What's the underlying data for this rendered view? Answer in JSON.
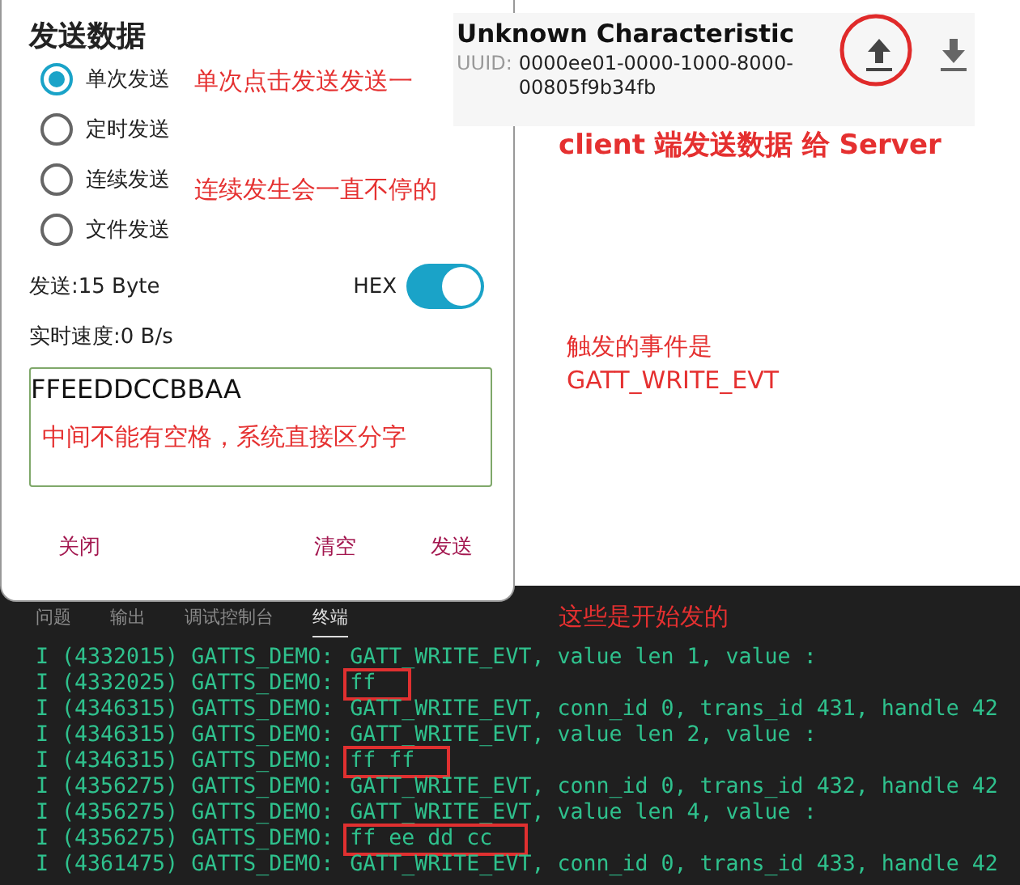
{
  "dialog": {
    "title": "发送数据",
    "options": [
      {
        "label": "单次发送",
        "selected": true
      },
      {
        "label": "定时发送",
        "selected": false
      },
      {
        "label": "连续发送",
        "selected": false
      },
      {
        "label": "文件发送",
        "selected": false
      }
    ],
    "sent": "发送:15 Byte",
    "hex": {
      "label": "HEX",
      "on": true
    },
    "speed": "实时速度:0 B/s",
    "input": {
      "value": "FFEEDDCCBBAA"
    },
    "buttons": [
      "关闭",
      "清空",
      "发送"
    ]
  },
  "characteristic": {
    "name": "Unknown Characteristic",
    "uuid_label": "UUID:",
    "uuid": "0000ee01-0000-1000-8000-00805f9b34fb"
  },
  "annotations": [
    "单次点击发送发送一",
    "连续发生会一直不停的",
    "中间不能有空格，系统直接区分字",
    "client 端发送数据 给 Server",
    "触发的事件是\nGATT_WRITE_EVT",
    "这些是开始发的"
  ],
  "terminal": {
    "tabs": [
      {
        "label": "问题",
        "selected": false
      },
      {
        "label": "输出",
        "selected": false
      },
      {
        "label": "调试控制台",
        "selected": false
      },
      {
        "label": "终端",
        "selected": true
      }
    ],
    "lines": [
      {
        "head": "I (4332015) GATTS_DEMO:",
        "body": "GATT_WRITE_EVT, value len 1, value :",
        "boxed": false
      },
      {
        "head": "I (4332025) GATTS_DEMO:",
        "body": "ff",
        "boxed": true
      },
      {
        "head": "I (4346315) GATTS_DEMO:",
        "body": "GATT_WRITE_EVT, conn_id 0, trans_id 431, handle 42",
        "boxed": false
      },
      {
        "head": "I (4346315) GATTS_DEMO:",
        "body": "GATT_WRITE_EVT, value len 2, value :",
        "boxed": false
      },
      {
        "head": "I (4346315) GATTS_DEMO:",
        "body": "ff ff",
        "boxed": true
      },
      {
        "head": "I (4356275) GATTS_DEMO:",
        "body": "GATT_WRITE_EVT, conn_id 0, trans_id 432, handle 42",
        "boxed": false
      },
      {
        "head": "I (4356275) GATTS_DEMO:",
        "body": "GATT_WRITE_EVT, value len 4, value :",
        "boxed": false
      },
      {
        "head": "I (4356275) GATTS_DEMO:",
        "body": "ff ee dd cc",
        "boxed": true
      },
      {
        "head": "I (4361475) GATTS_DEMO:",
        "body": "GATT_WRITE_EVT, conn_id 0, trans_id 433, handle 42",
        "boxed": false
      }
    ]
  }
}
